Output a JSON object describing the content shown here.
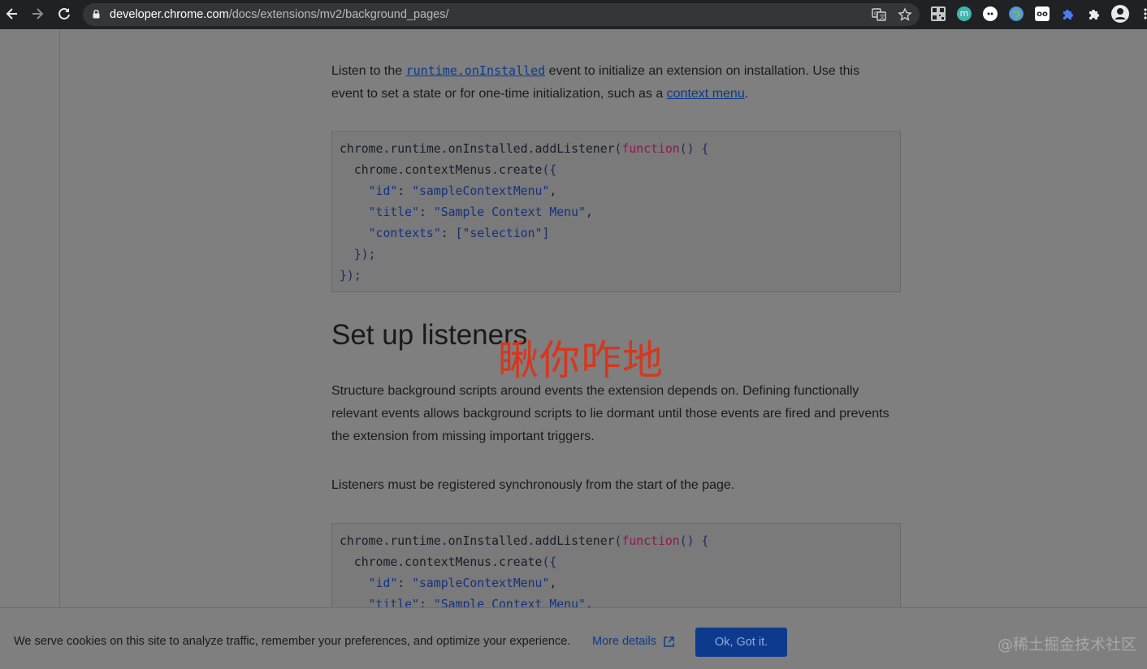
{
  "browser": {
    "url_host": "developer.chrome.com",
    "url_path": "/docs/extensions/mv2/background_pages/",
    "icons": {
      "back": "arrow-left-icon",
      "forward": "arrow-right-icon",
      "reload": "reload-icon",
      "lock": "lock-icon",
      "translate": "translate-icon",
      "bookmark": "star-icon",
      "extensions": "puzzle-icon",
      "profile": "profile-icon",
      "menu": "kebab-menu-icon"
    },
    "extension_badges": [
      "qr",
      "m",
      "",
      "",
      "oo",
      "",
      ""
    ]
  },
  "article": {
    "intro": {
      "before_link": "Listen to the ",
      "link1": "runtime.onInstalled",
      "middle": " event to initialize an extension on installation. Use this event to set a state or for one-time initialization, such as a ",
      "link2": "context menu",
      "after": "."
    },
    "code_block_1": [
      "chrome.runtime.onInstalled.addListener(function() {",
      "  chrome.contextMenus.create({",
      "    \"id\": \"sampleContextMenu\",",
      "    \"title\": \"Sample Context Menu\",",
      "    \"contexts\": [\"selection\"]",
      "  });",
      "});"
    ],
    "heading": "Set up listeners",
    "paragraph_1": "Structure background scripts around events the extension depends on. Defining functionally relevant events allows background scripts to lie dormant until those events are fired and prevents the extension from missing important triggers.",
    "paragraph_2": "Listeners must be registered synchronously from the start of the page.",
    "code_block_2": [
      "chrome.runtime.onInstalled.addListener(function() {",
      "  chrome.contextMenus.create({",
      "    \"id\": \"sampleContextMenu\",",
      "    \"title\": \"Sample Context Menu\","
    ]
  },
  "overlay_text": "瞅你咋地",
  "cookie_banner": {
    "message": "We serve cookies on this site to analyze traffic, remember your preferences, and optimize your experience.",
    "more_details": "More details",
    "ok_button": "Ok, Got it."
  },
  "watermark": "@稀土掘金技术社区",
  "colors": {
    "dim_overlay": "#7f7f7f",
    "toolbar": "#202124",
    "link": "#0b3a8a",
    "overlay_text": "#d4381f",
    "button": "#0e3a8e"
  }
}
